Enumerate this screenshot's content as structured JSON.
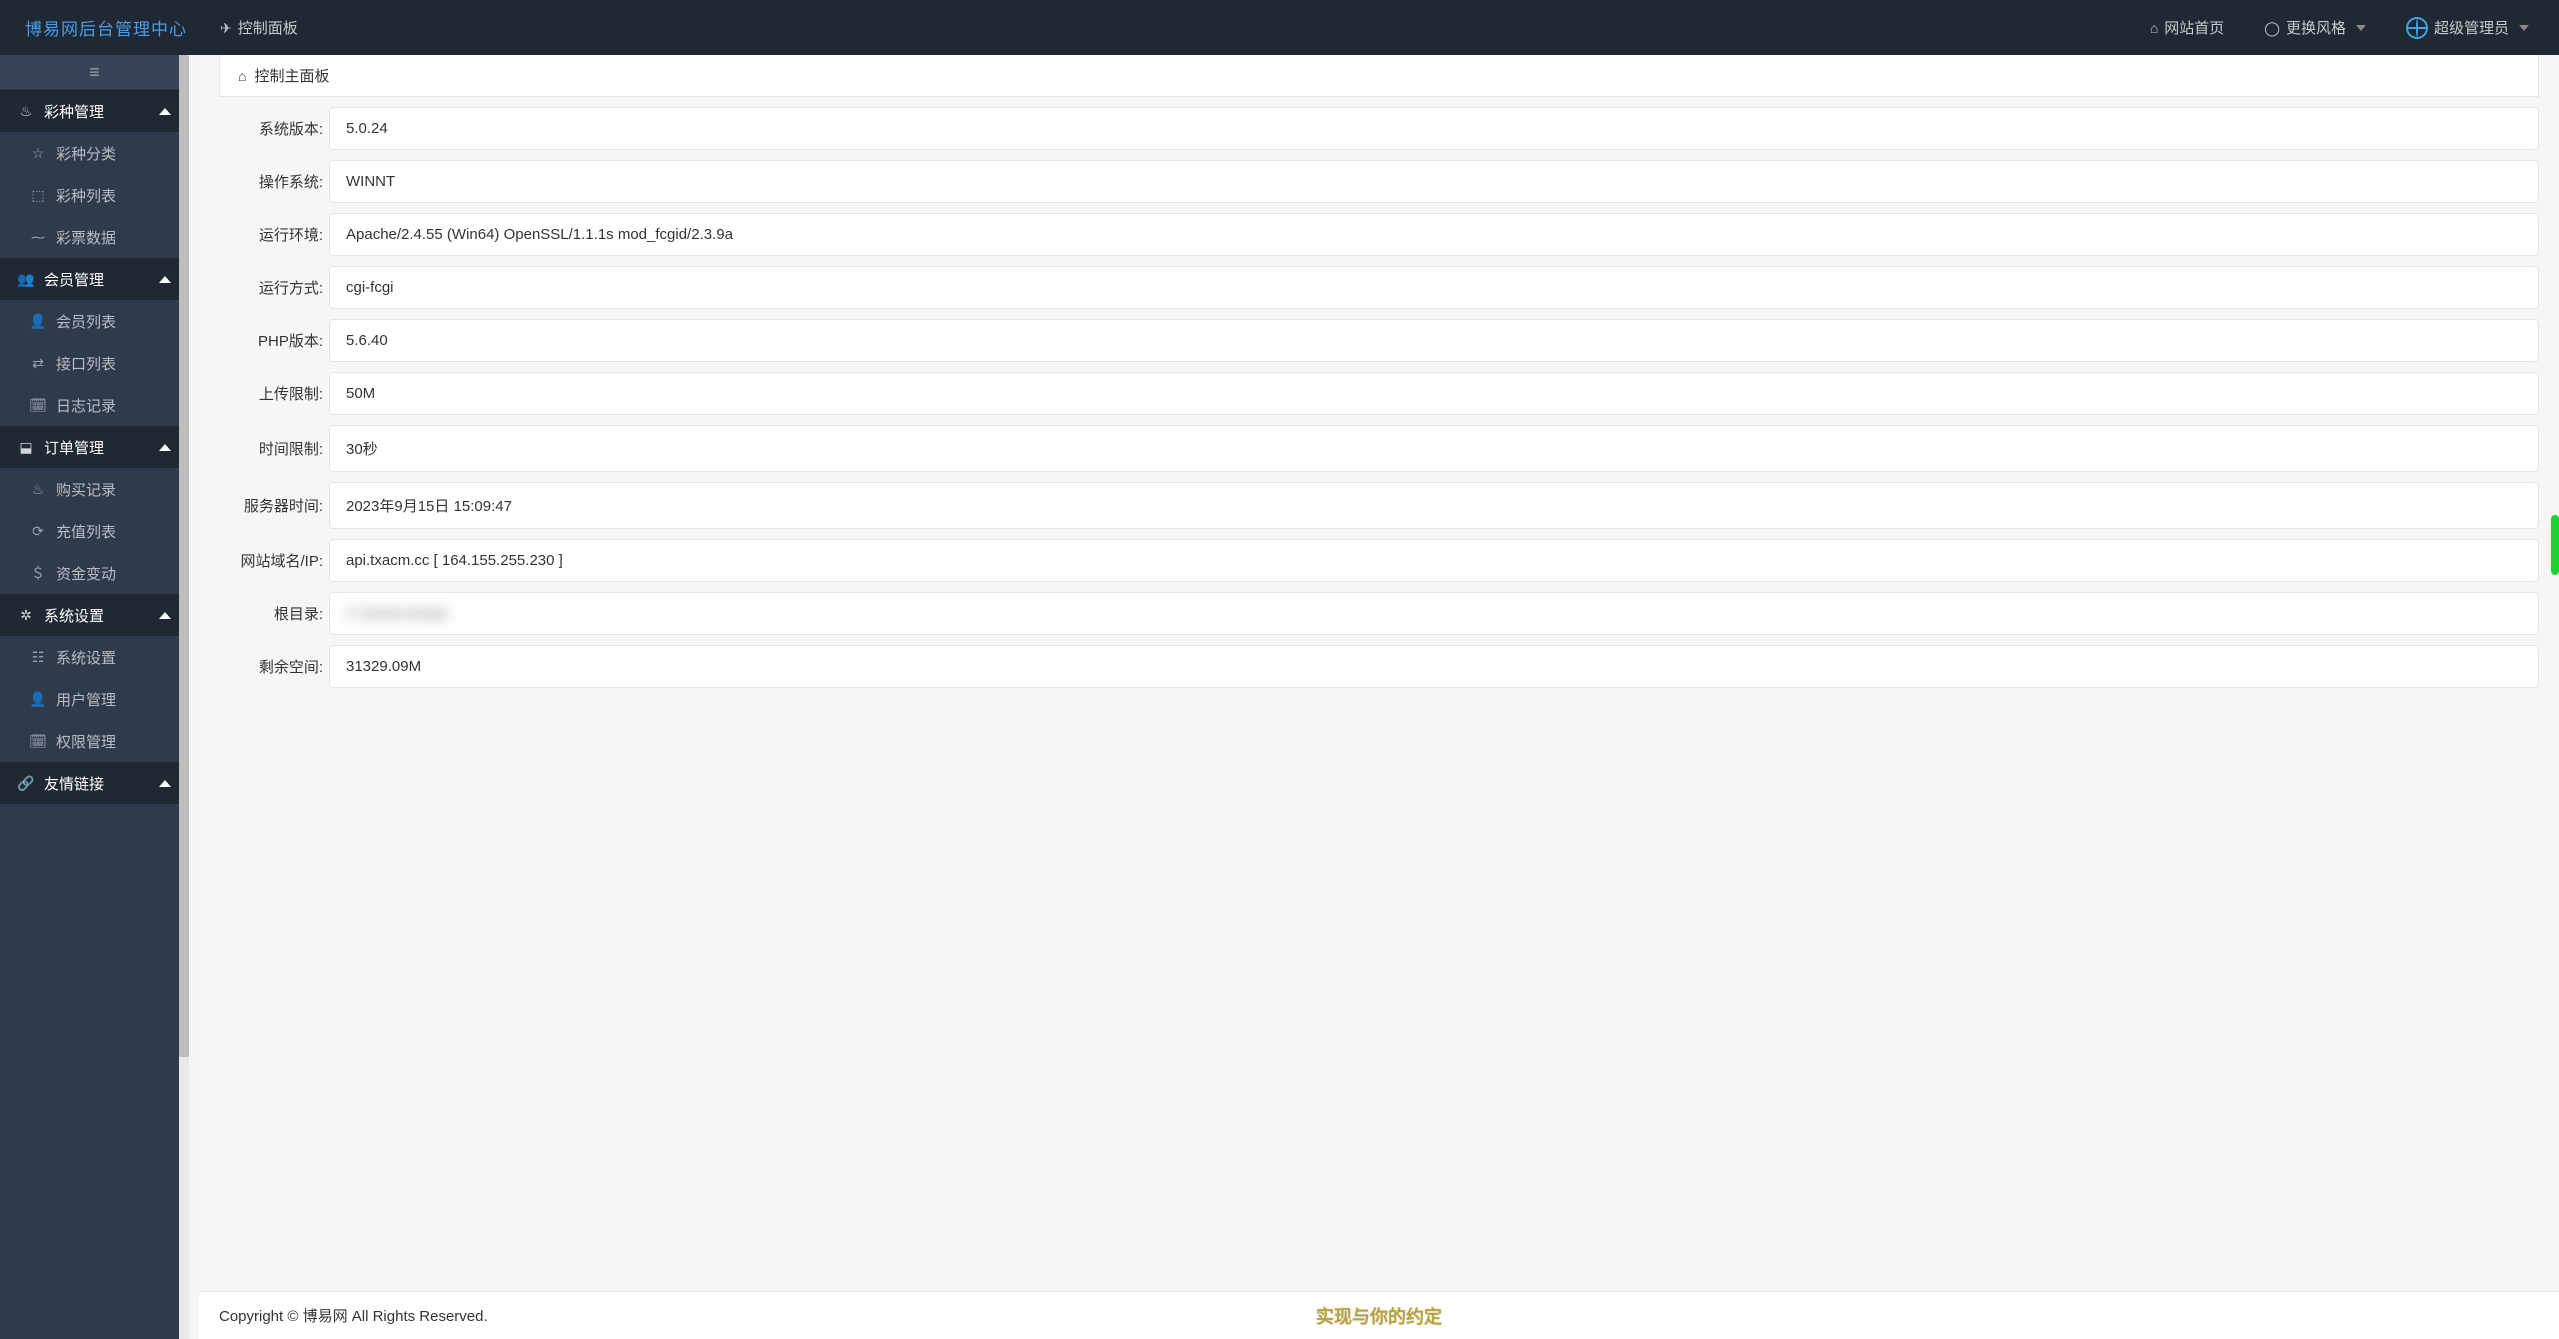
{
  "brand": "博易网后台管理中心",
  "top": {
    "tab_label": "控制面板",
    "home_label": "网站首页",
    "theme_label": "更换风格",
    "user_label": "超级管理员"
  },
  "panel": {
    "title": "控制主面板"
  },
  "sidebar": {
    "groups": [
      {
        "label": "彩种管理",
        "icon": "flame-icon",
        "items": [
          {
            "label": "彩种分类",
            "icon": "star-icon"
          },
          {
            "label": "彩种列表",
            "icon": "cube-icon"
          },
          {
            "label": "彩票数据",
            "icon": "pulse-icon"
          }
        ]
      },
      {
        "label": "会员管理",
        "icon": "users-icon",
        "items": [
          {
            "label": "会员列表",
            "icon": "person-icon"
          },
          {
            "label": "接口列表",
            "icon": "link-icon"
          },
          {
            "label": "日志记录",
            "icon": "calendar-icon"
          }
        ]
      },
      {
        "label": "订单管理",
        "icon": "box-icon",
        "items": [
          {
            "label": "购买记录",
            "icon": "flame-icon"
          },
          {
            "label": "充值列表",
            "icon": "circle-arrow-icon"
          },
          {
            "label": "资金变动",
            "icon": "dollar-icon"
          }
        ]
      },
      {
        "label": "系统设置",
        "icon": "gear-icon",
        "items": [
          {
            "label": "系统设置",
            "icon": "sliders-icon"
          },
          {
            "label": "用户管理",
            "icon": "person-icon"
          },
          {
            "label": "权限管理",
            "icon": "calendar-icon"
          }
        ]
      },
      {
        "label": "友情链接",
        "icon": "chain-icon",
        "items": []
      }
    ]
  },
  "info": [
    {
      "label": "系统版本:",
      "value": "5.0.24"
    },
    {
      "label": "操作系统:",
      "value": "WINNT"
    },
    {
      "label": "运行环境:",
      "value": "Apache/2.4.55 (Win64) OpenSSL/1.1.1s mod_fcgid/2.3.9a"
    },
    {
      "label": "运行方式:",
      "value": "cgi-fcgi"
    },
    {
      "label": "PHP版本:",
      "value": "5.6.40"
    },
    {
      "label": "上传限制:",
      "value": "50M"
    },
    {
      "label": "时间限制:",
      "value": "30秒"
    },
    {
      "label": "服务器时间:",
      "value": "2023年9月15日 15:09:47"
    },
    {
      "label": "网站域名/IP:",
      "value": "api.txacm.cc [ 164.155.255.230 ]"
    },
    {
      "label": "根目录:",
      "value": "C:\\wwwroot\\api",
      "blurred": true
    },
    {
      "label": "剩余空间:",
      "value": "31329.09M"
    }
  ],
  "footer": {
    "copyright": "Copyright © 博易网 All Rights Reserved.",
    "center_text": "实现与你的约定"
  },
  "icon_glyphs": {
    "flame-icon": "♨",
    "star-icon": "☆",
    "cube-icon": "⬚",
    "pulse-icon": "⁓",
    "users-icon": "👥",
    "person-icon": "👤",
    "link-icon": "⇄",
    "calendar-icon": "🗓",
    "box-icon": "⬓",
    "circle-arrow-icon": "⟳",
    "dollar-icon": "＄",
    "gear-icon": "✲",
    "sliders-icon": "☷",
    "chain-icon": "🔗",
    "home-icon": "⌂",
    "refresh-icon": "◯",
    "send-icon": "✈"
  }
}
